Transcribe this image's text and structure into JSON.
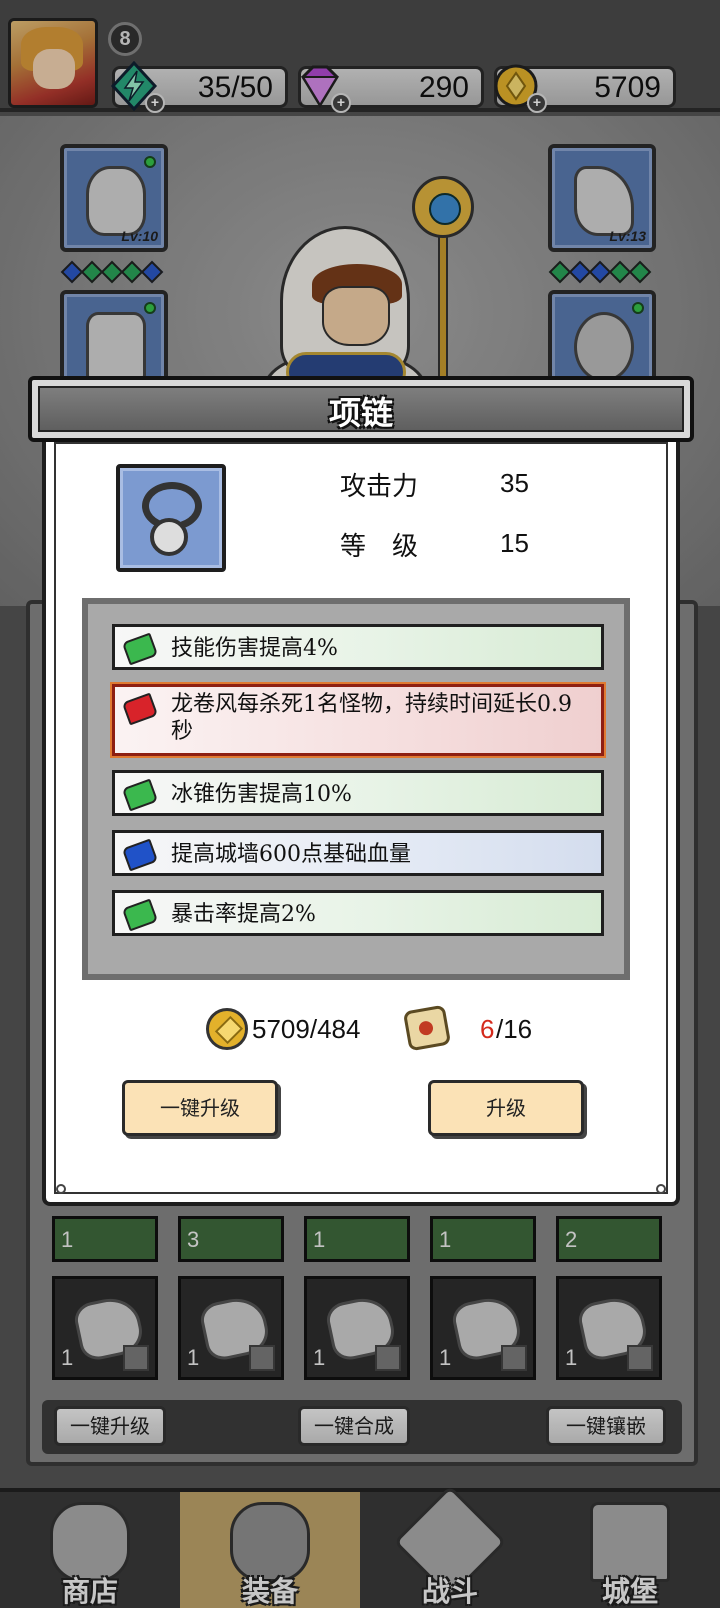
{
  "player": {
    "level": "8"
  },
  "resources": [
    {
      "name": "energy",
      "value": "35/50",
      "icon": "lightning-icon",
      "color": "#2aa77f"
    },
    {
      "name": "gems",
      "value": "290",
      "icon": "diamond-icon",
      "color": "#b04bd1"
    },
    {
      "name": "gold",
      "value": "5709",
      "icon": "coin-icon",
      "color": "#e3b12b"
    }
  ],
  "equipment": {
    "slot_helmet_level": "Lv:10",
    "slot_gloves_level": "Lv:13"
  },
  "modal": {
    "title": "项链",
    "stats": [
      {
        "label": "攻击力",
        "value": "35"
      },
      {
        "label": "等　级",
        "value": "15"
      }
    ],
    "effects": [
      {
        "gem": "green",
        "text": "技能伤害提高4%"
      },
      {
        "gem": "red",
        "text": "龙卷风每杀死1名怪物，持续时间延长0.9秒"
      },
      {
        "gem": "green",
        "text": "冰锥伤害提高10%"
      },
      {
        "gem": "blue",
        "text": "提高城墙600点基础血量"
      },
      {
        "gem": "green",
        "text": "暴击率提高2%"
      }
    ],
    "gold_cost": "5709/484",
    "scroll_have": "6",
    "scroll_need": "/16",
    "btn_upgrade_all": "一键升级",
    "btn_upgrade": "升级"
  },
  "inventory": {
    "top_counts": [
      "1",
      "3",
      "1",
      "1",
      "2"
    ],
    "stone_counts": [
      "1",
      "1",
      "1",
      "1",
      "1"
    ],
    "btn_upgrade_all": "一键升级",
    "btn_merge_all": "一键合成",
    "btn_inlay_all": "一键镶嵌"
  },
  "nav": [
    {
      "label": "商店",
      "icon": "shop-icon"
    },
    {
      "label": "装备",
      "icon": "backpack-icon"
    },
    {
      "label": "战斗",
      "icon": "crossed-swords-icon"
    },
    {
      "label": "城堡",
      "icon": "castle-icon"
    }
  ],
  "colors": {
    "accent_button": "#fbe2b6",
    "danger_text": "#d42a1c",
    "slot_blue": "#5a7bb0"
  }
}
